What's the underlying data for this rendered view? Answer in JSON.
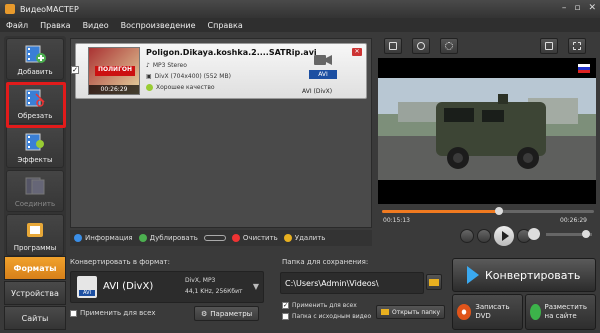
{
  "window": {
    "title": "ВидеоМАСТЕР",
    "min": "–",
    "max": "▫",
    "close": "✕"
  },
  "menu": [
    "Файл",
    "Правка",
    "Видео",
    "Воспроизведение",
    "Справка"
  ],
  "sidebar": {
    "items": [
      {
        "label": "Добавить",
        "icon": "add-film-icon"
      },
      {
        "label": "Обрезать",
        "icon": "cut-film-icon"
      },
      {
        "label": "Эффекты",
        "icon": "effects-film-icon"
      },
      {
        "label": "Соединить",
        "icon": "join-film-icon",
        "disabled": true
      },
      {
        "label": "Программы",
        "icon": "programs-icon"
      }
    ]
  },
  "bottomnav": {
    "formats": "Форматы",
    "devices": "Устройства",
    "sites": "Сайты"
  },
  "file": {
    "checked": "✓",
    "name": "Poligon.Dikaya.koshka.2....SATRip.avi",
    "audio": "MP3 Stereo",
    "video": "DivX (704x400) (552 MB)",
    "quality": "Хорошее качество",
    "thumb_label": "ПОЛИГОН",
    "duration": "00:26:29",
    "format_badge": "AVI",
    "format_label": "AVI (DivX)",
    "close": "✕"
  },
  "actions": {
    "info": "Информация",
    "duplicate": "Дублировать",
    "clear": "Очистить",
    "delete": "Удалить"
  },
  "format_panel": {
    "label": "Конвертировать в формат:",
    "name": "AVI (DivX)",
    "badge": "AVI",
    "spec1": "DivX, MP3",
    "spec2": "44,1 KHz, 256Кбит",
    "caret": "▼",
    "apply_all": "Применить для всех",
    "params": "Параметры"
  },
  "save_panel": {
    "label": "Папка для сохранения:",
    "path": "C:\\Users\\Admin\\Videos\\",
    "apply_all": "Применить для всех",
    "source_folder": "Папка с исходным видео",
    "open_folder": "Открыть папку",
    "apply_checked": "✓"
  },
  "convert": {
    "main": "Конвертировать",
    "dvd": "Записать DVD",
    "site": "Разместить на сайте"
  },
  "player": {
    "current": "00:15:13",
    "total": "00:26:29",
    "progress": 0.55,
    "volume": 0.8
  }
}
